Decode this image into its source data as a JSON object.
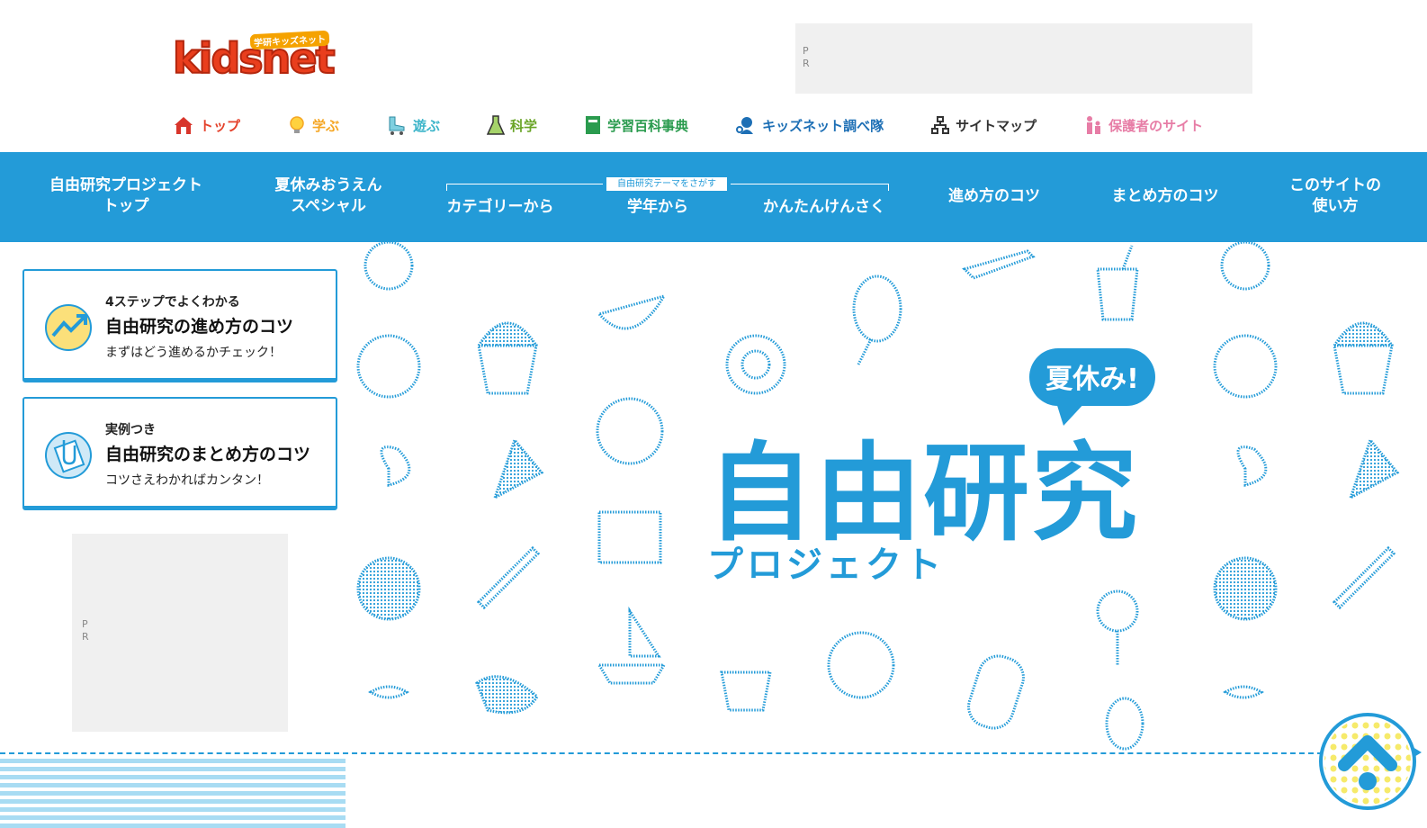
{
  "header": {
    "logo_text": "kidsnet",
    "logo_sub": "学研キッズネット",
    "pr_label": "PR"
  },
  "topnav": [
    {
      "label": "トップ",
      "color": "#e4412b",
      "icon": "house-icon"
    },
    {
      "label": "学ぶ",
      "color": "#f5a623",
      "icon": "lightbulb-icon"
    },
    {
      "label": "遊ぶ",
      "color": "#3bb4c9",
      "icon": "roller-skate-icon"
    },
    {
      "label": "科学",
      "color": "#6aa527",
      "icon": "flask-icon"
    },
    {
      "label": "学習百科事典",
      "color": "#2a9b4e",
      "icon": "book-icon"
    },
    {
      "label": "キッズネット調べ隊",
      "color": "#1d6fb5",
      "icon": "detective-icon"
    },
    {
      "label": "サイトマップ",
      "color": "#333333",
      "icon": "sitemap-icon"
    },
    {
      "label": "保護者のサイト",
      "color": "#e77da6",
      "icon": "family-icon"
    }
  ],
  "bluenav": {
    "project_top": [
      "自由研究プロジェクト",
      "トップ"
    ],
    "summer_special": [
      "夏休みおうえん",
      "スペシャル"
    ],
    "theme_label": "自由研究テーマをさがす",
    "by_category": "カテゴリーから",
    "by_grade": "学年から",
    "easy_search": "かんたんけんさく",
    "tips_progress": "進め方のコツ",
    "tips_summary": "まとめ方のコツ",
    "how_to_use": [
      "このサイトの",
      "使い方"
    ]
  },
  "hero": {
    "bubble": "夏休み!",
    "title": "自由研究",
    "subtitle": "プロジェクト"
  },
  "cards": [
    {
      "kicker": "4ステップでよくわかる",
      "title": "自由研究の進め方のコツ",
      "sub": "まずはどう進めるかチェック！"
    },
    {
      "kicker": "実例つき",
      "title": "自由研究のまとめ方のコツ",
      "sub": "コツさえわかればカンタン！"
    }
  ],
  "sidebar_pr": "PR",
  "colors": {
    "brand_blue": "#239bd8",
    "stripe_blue": "#a8dcf3",
    "logo_red": "#e93e1d"
  }
}
